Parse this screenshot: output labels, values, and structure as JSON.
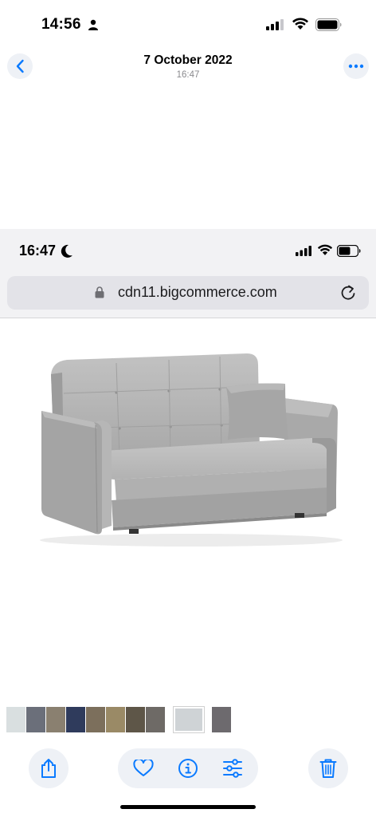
{
  "status_bar": {
    "time": "14:56"
  },
  "nav": {
    "title": "7 October 2022",
    "subtitle": "16:47",
    "back_icon": "chevron-left-icon",
    "more_icon": "ellipsis-icon"
  },
  "screenshot": {
    "status_time": "16:47",
    "url": "cdn11.bigcommerce.com",
    "image_subject": "grey sofa bed"
  },
  "toolbar": {
    "share_icon": "share-icon",
    "favorite_icon": "heart-icon",
    "info_icon": "info-icon",
    "adjust_icon": "sliders-icon",
    "delete_icon": "trash-icon"
  },
  "colors": {
    "accent": "#0a7aff",
    "button_bg": "#eef1f6",
    "sofa": "#b4b4b4"
  },
  "filmstrip": {
    "thumbs": [
      "#d9dfe0",
      "#6b6f7a",
      "#8a8070",
      "#2f3b5c",
      "#7c6f5c",
      "#9a8a66",
      "#5e5648",
      "#6e6a66",
      "#cfd3d6",
      "#6d6a6e"
    ]
  }
}
